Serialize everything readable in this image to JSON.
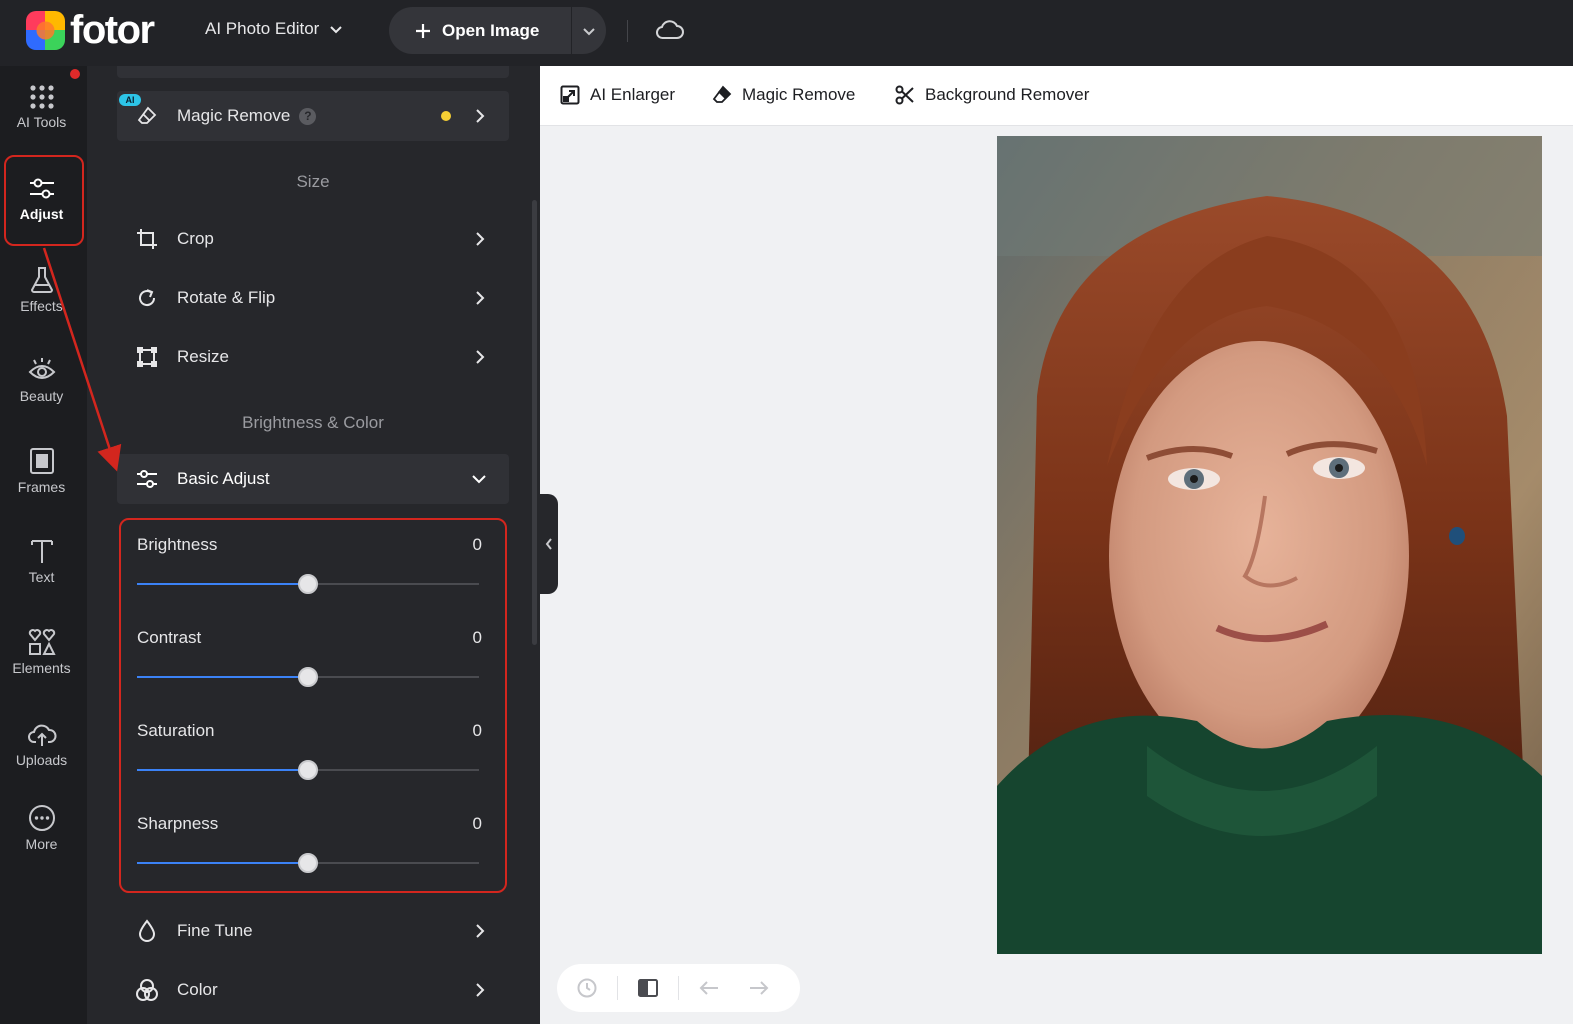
{
  "header": {
    "brand": "fotor",
    "editor_mode": "AI Photo Editor",
    "open_image_label": "Open Image"
  },
  "rail": {
    "items": [
      {
        "label": "AI Tools",
        "icon": "grid-dots-icon"
      },
      {
        "label": "Adjust",
        "icon": "sliders-icon",
        "active": true
      },
      {
        "label": "Effects",
        "icon": "flask-icon"
      },
      {
        "label": "Beauty",
        "icon": "eye-icon"
      },
      {
        "label": "Frames",
        "icon": "frame-icon"
      },
      {
        "label": "Text",
        "icon": "text-icon"
      },
      {
        "label": "Elements",
        "icon": "shapes-icon"
      },
      {
        "label": "Uploads",
        "icon": "cloud-upload-icon"
      },
      {
        "label": "More",
        "icon": "more-dots-icon"
      }
    ]
  },
  "panel": {
    "magic_remove": {
      "label": "Magic Remove",
      "badge": "AI",
      "help": "?"
    },
    "size_section": "Size",
    "size_items": [
      "Crop",
      "Rotate & Flip",
      "Resize"
    ],
    "brightness_section": "Brightness & Color",
    "basic_adjust": "Basic Adjust",
    "sliders": [
      {
        "label": "Brightness",
        "value": 0,
        "fraction": 0.5
      },
      {
        "label": "Contrast",
        "value": 0,
        "fraction": 0.5
      },
      {
        "label": "Saturation",
        "value": 0,
        "fraction": 0.5
      },
      {
        "label": "Sharpness",
        "value": 0,
        "fraction": 0.5
      }
    ],
    "more_items": [
      "Fine Tune",
      "Color"
    ]
  },
  "toolbar": {
    "ai_enlarger": "AI Enlarger",
    "magic_remove": "Magic Remove",
    "background_remover": "Background Remover"
  },
  "colors": {
    "accent": "#3b82f6",
    "highlight": "#d3261e",
    "panel": "#26272b"
  }
}
